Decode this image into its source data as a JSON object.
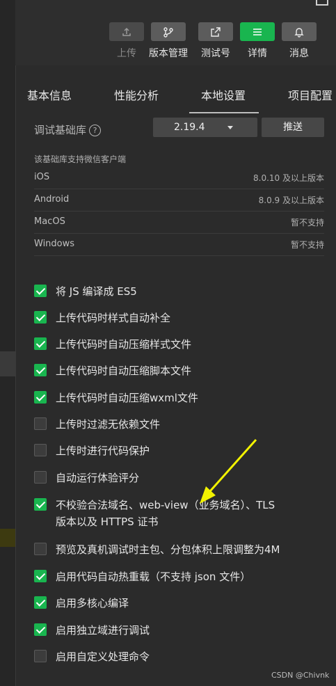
{
  "toolbar": {
    "buttons": [
      {
        "label": "上传",
        "icon": "upload-icon"
      },
      {
        "label": "版本管理",
        "icon": "branch-icon"
      },
      {
        "label": "测试号",
        "icon": "external-link-icon"
      },
      {
        "label": "详情",
        "icon": "menu-icon"
      },
      {
        "label": "消息",
        "icon": "bell-icon"
      }
    ]
  },
  "tabs": [
    "基本信息",
    "性能分析",
    "本地设置",
    "项目配置"
  ],
  "active_tab": "本地设置",
  "debug_lib": {
    "label": "调试基础库",
    "help": "?",
    "selected": "2.19.4",
    "push_label": "推送"
  },
  "support": {
    "heading": "该基础库支持微信客户端",
    "platforms": [
      {
        "name": "iOS",
        "version": "8.0.10 及以上版本"
      },
      {
        "name": "Android",
        "version": "8.0.9 及以上版本"
      },
      {
        "name": "MacOS",
        "version": "暂不支持"
      },
      {
        "name": "Windows",
        "version": "暂不支持"
      }
    ]
  },
  "options": [
    {
      "label": "将 JS 编译成 ES5",
      "checked": true
    },
    {
      "label": "上传代码时样式自动补全",
      "checked": true
    },
    {
      "label": "上传代码时自动压缩样式文件",
      "checked": true
    },
    {
      "label": "上传代码时自动压缩脚本文件",
      "checked": true
    },
    {
      "label": "上传代码时自动压缩wxml文件",
      "checked": true
    },
    {
      "label": "上传时过滤无依赖文件",
      "checked": false
    },
    {
      "label": "上传时进行代码保护",
      "checked": false
    },
    {
      "label": "自动运行体验评分",
      "checked": false
    },
    {
      "label": "不校验合法域名、web-view（业务域名）、TLS",
      "label2": "版本以及 HTTPS 证书",
      "checked": true
    },
    {
      "label": "预览及真机调试时主包、分包体积上限调整为4M",
      "checked": false
    },
    {
      "label": "启用代码自动热重载（不支持 json 文件）",
      "checked": true
    },
    {
      "label": "启用多核心编译",
      "checked": true
    },
    {
      "label": "启用独立域进行调试",
      "checked": true
    },
    {
      "label": "启用自定义处理命令",
      "checked": false
    }
  ],
  "colors": {
    "accent": "#19b54f",
    "annotation_arrow": "#f2f200"
  },
  "watermark": "CSDN @Chivnk"
}
